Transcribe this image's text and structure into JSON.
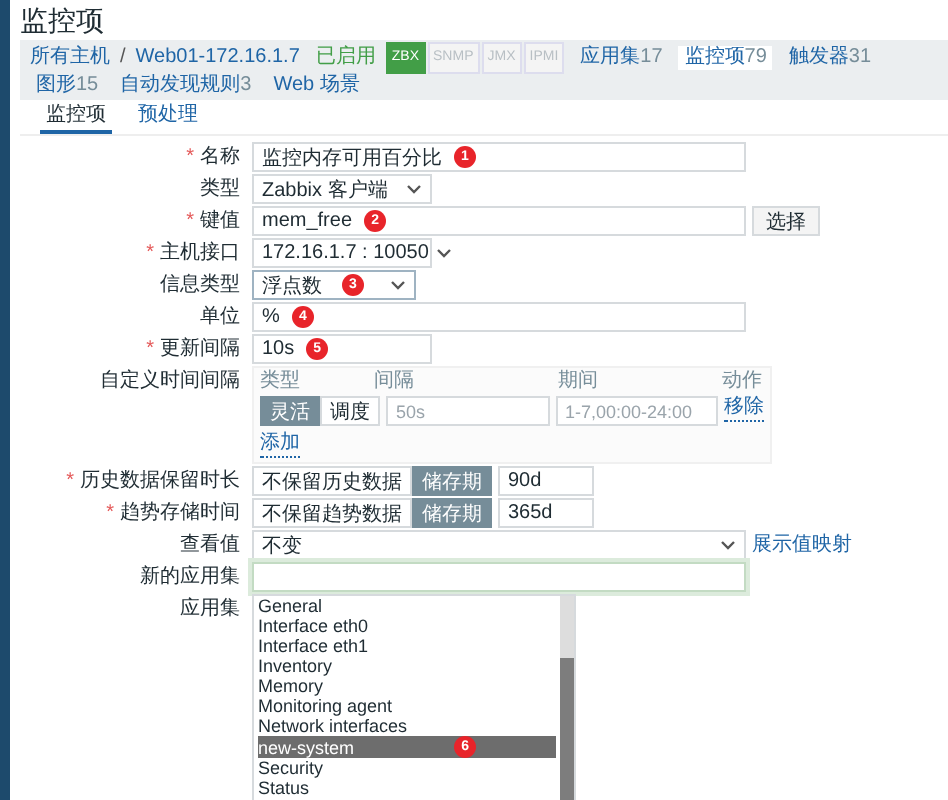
{
  "page_title": "监控项",
  "breadcrumb": [
    {
      "label": "所有主机"
    },
    {
      "separator": "/",
      "label": "Web01-172.16.1.7"
    }
  ],
  "status": "已启用",
  "availability": [
    {
      "label": "ZBX",
      "on": true
    },
    {
      "label": "SNMP",
      "on": false
    },
    {
      "label": "JMX",
      "on": false
    },
    {
      "label": "IPMI",
      "on": false
    }
  ],
  "nav_tabs": [
    {
      "label": "应用集",
      "count": "17",
      "selected": false
    },
    {
      "label": "监控项",
      "count": "79",
      "selected": true
    },
    {
      "label": "触发器",
      "count": "31",
      "selected": false
    },
    {
      "label": "图形",
      "count": "15",
      "selected": false
    },
    {
      "label": "自动发现规则",
      "count": "3",
      "selected": false
    },
    {
      "label": "Web 场景",
      "selected": false
    }
  ],
  "sub_tabs": [
    {
      "label": "监控项",
      "selected": true
    },
    {
      "label": "预处理",
      "selected": false
    }
  ],
  "form": [
    {
      "kind": "text",
      "label": "名称",
      "mark": "*",
      "value": "监控内存可用百分比",
      "badge": "1",
      "focused": false
    },
    {
      "kind": "select",
      "label": "类型",
      "value": "Zabbix 客户端"
    },
    {
      "kind": "text_button",
      "label": "键值",
      "mark": "*",
      "value": "mem_free",
      "badge": "2",
      "button": "选择",
      "focused": false
    },
    {
      "kind": "select",
      "label": "主机接口",
      "mark": "*",
      "value": "172.16.1.7 : 10050"
    },
    {
      "kind": "small_select",
      "label": "信息类型",
      "value": "浮点数",
      "badge": "3"
    },
    {
      "kind": "text",
      "label": "单位",
      "value": "%",
      "badge": "4",
      "focused": false
    },
    {
      "kind": "short_text",
      "label": "更新间隔",
      "mark": "*",
      "value": "10s",
      "badge": "5",
      "focused": false
    },
    {
      "kind": "intervals",
      "label": "自定义时间间隔",
      "columns": [
        "类型",
        "间隔",
        "期间",
        "动作"
      ],
      "rows": [
        {
          "modes": [
            {
              "label": "灵活",
              "selected": true
            },
            {
              "label": "调度",
              "selected": false
            }
          ],
          "interval_placeholder": "50s",
          "period_placeholder": "1-7,00:00-24:00",
          "action": "移除"
        }
      ],
      "add": "添加"
    },
    {
      "kind": "storage",
      "label": "历史数据保留时长",
      "mark": "*",
      "options": [
        {
          "label": "不保留历史数据",
          "selected": false
        },
        {
          "label": "储存期",
          "selected": true
        }
      ],
      "value": "90d"
    },
    {
      "kind": "storage",
      "label": "趋势存储时间",
      "mark": "*",
      "options": [
        {
          "label": "不保留趋势数据",
          "selected": false
        },
        {
          "label": "储存期",
          "selected": true
        }
      ],
      "value": "365d"
    },
    {
      "kind": "select_link",
      "label": "查看值",
      "value": "不变",
      "link": "展示值映射"
    },
    {
      "kind": "text",
      "label": "新的应用集",
      "focused": true
    },
    {
      "kind": "listbox",
      "label": "应用集",
      "items": [
        {
          "label": "General",
          "selected": false
        },
        {
          "label": "Interface eth0",
          "selected": false
        },
        {
          "label": "Interface eth1",
          "selected": false
        },
        {
          "label": "Inventory",
          "selected": false
        },
        {
          "label": "Memory",
          "selected": false
        },
        {
          "label": "Monitoring agent",
          "selected": false
        },
        {
          "label": "Network interfaces",
          "selected": false
        },
        {
          "label": "new-system",
          "selected": true,
          "badge": "6"
        },
        {
          "label": "Security",
          "selected": false
        },
        {
          "label": "Status",
          "selected": false
        }
      ]
    }
  ]
}
